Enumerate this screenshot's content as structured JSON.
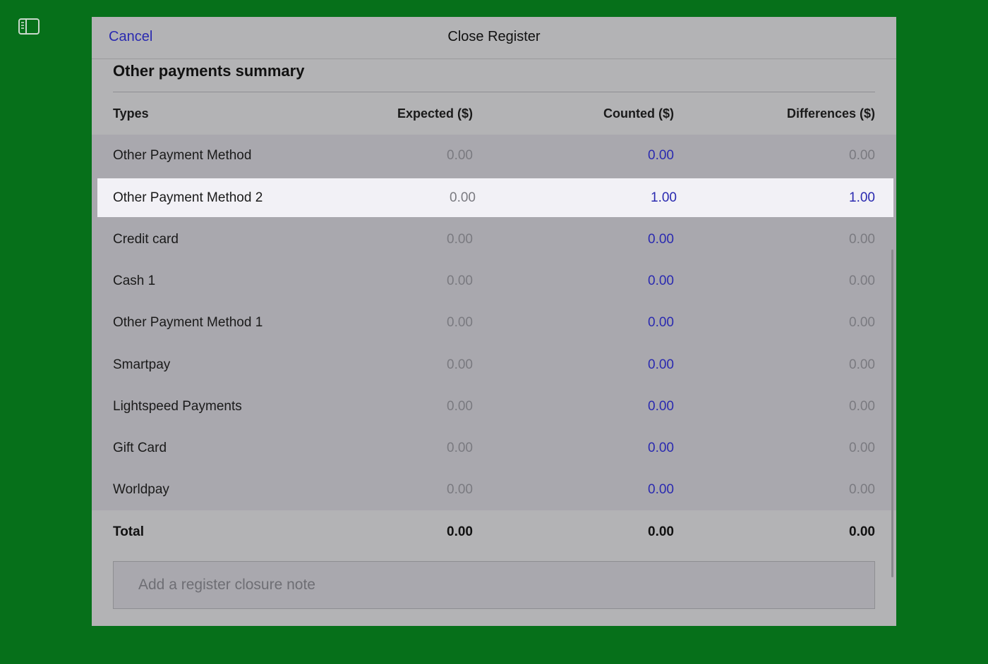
{
  "sidebar_toggle_icon": "sidebar-toggle-icon",
  "header": {
    "cancel_label": "Cancel",
    "title": "Close Register"
  },
  "section": {
    "title": "Other payments summary"
  },
  "table": {
    "headers": {
      "type": "Types",
      "expected": "Expected ($)",
      "counted": "Counted ($)",
      "differences": "Differences ($)"
    },
    "rows": [
      {
        "type": "Other Payment Method",
        "expected": "0.00",
        "counted": "0.00",
        "differences": "0.00"
      },
      {
        "type": "Other Payment Method 2",
        "expected": "0.00",
        "counted": "1.00",
        "differences": "1.00"
      },
      {
        "type": "Credit card",
        "expected": "0.00",
        "counted": "0.00",
        "differences": "0.00"
      },
      {
        "type": "Cash 1",
        "expected": "0.00",
        "counted": "0.00",
        "differences": "0.00"
      },
      {
        "type": "Other Payment Method 1",
        "expected": "0.00",
        "counted": "0.00",
        "differences": "0.00"
      },
      {
        "type": "Smartpay",
        "expected": "0.00",
        "counted": "0.00",
        "differences": "0.00"
      },
      {
        "type": "Lightspeed Payments",
        "expected": "0.00",
        "counted": "0.00",
        "differences": "0.00"
      },
      {
        "type": "Gift Card",
        "expected": "0.00",
        "counted": "0.00",
        "differences": "0.00"
      },
      {
        "type": "Worldpay",
        "expected": "0.00",
        "counted": "0.00",
        "differences": "0.00"
      }
    ],
    "total": {
      "label": "Total",
      "expected": "0.00",
      "counted": "0.00",
      "differences": "0.00"
    }
  },
  "note": {
    "placeholder": "Add a register closure note",
    "value": ""
  },
  "colors": {
    "background": "#06701a",
    "accent": "#2a2ab0",
    "highlight_row": "#f2f1f6"
  }
}
